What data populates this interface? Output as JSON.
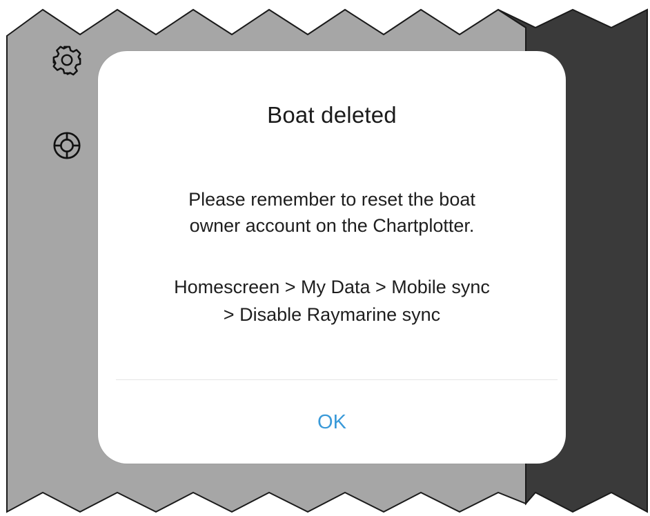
{
  "sidebar": {
    "icons": [
      {
        "name": "gear-icon"
      },
      {
        "name": "lifebuoy-icon"
      }
    ]
  },
  "dialog": {
    "title": "Boat deleted",
    "message_line1": "Please remember to reset the boat",
    "message_line2": "owner account on the Chartplotter.",
    "path_line1": "Homescreen > My Data > Mobile sync",
    "path_line2": "> Disable Raymarine sync",
    "ok_label": "OK"
  },
  "colors": {
    "background_gray": "#a6a6a6",
    "background_dark": "#3a3a3a",
    "accent": "#3a9ad9"
  }
}
